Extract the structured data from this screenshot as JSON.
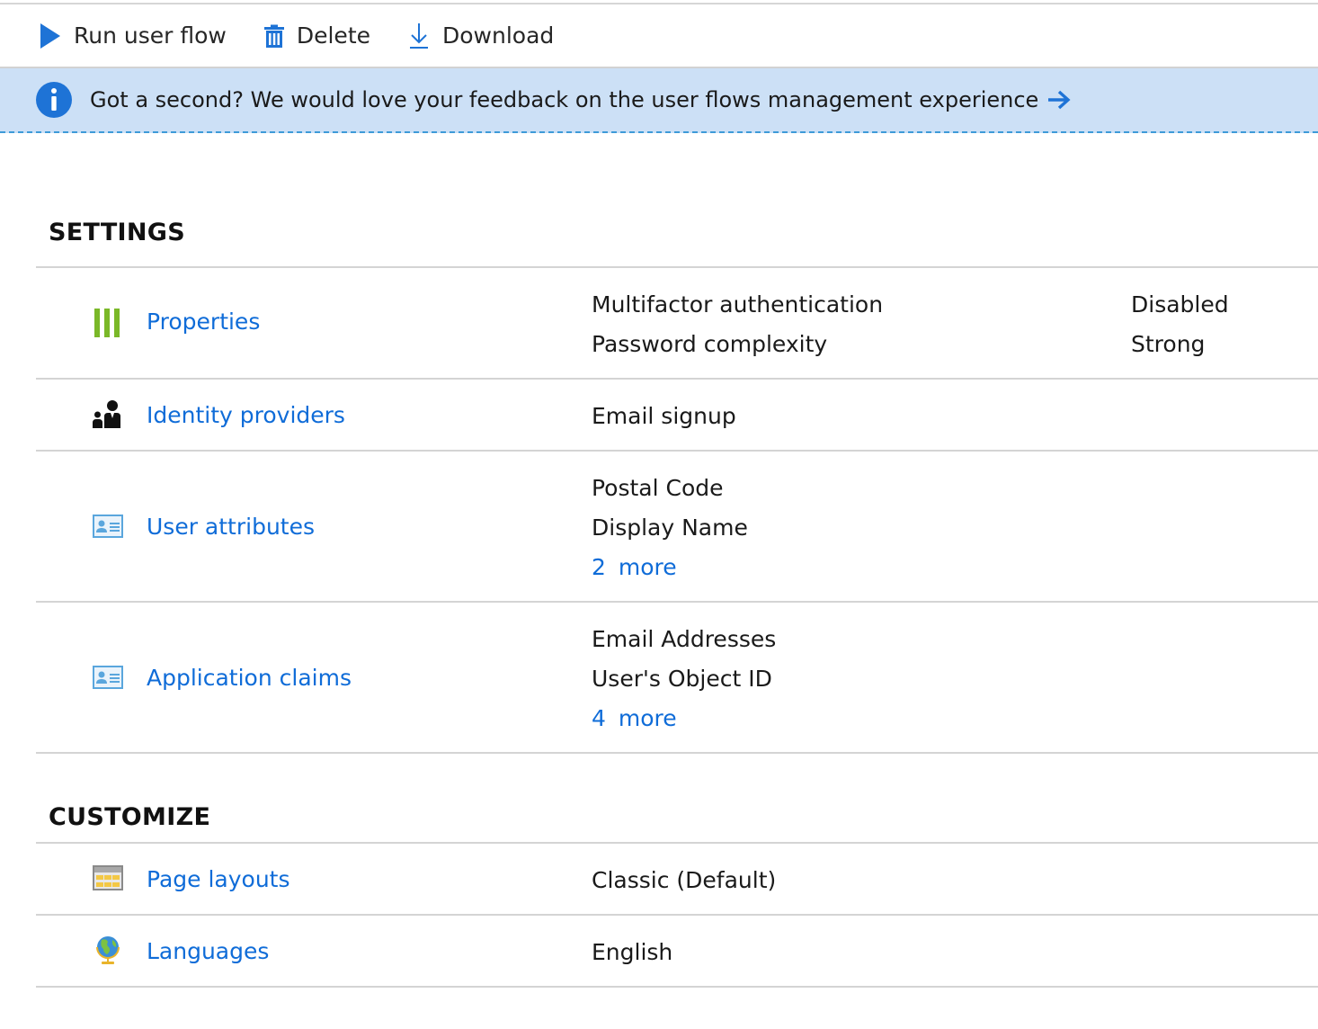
{
  "toolbar": {
    "run_label": "Run user flow",
    "delete_label": "Delete",
    "download_label": "Download"
  },
  "banner": {
    "message": "Got a second? We would love your feedback on the user flows management experience"
  },
  "settings": {
    "title": "SETTINGS",
    "properties": {
      "label": "Properties",
      "items": [
        {
          "name": "Multifactor authentication",
          "value": "Disabled"
        },
        {
          "name": "Password complexity",
          "value": "Strong"
        }
      ]
    },
    "identity_providers": {
      "label": "Identity providers",
      "values": [
        "Email signup"
      ]
    },
    "user_attributes": {
      "label": "User attributes",
      "values": [
        "Postal Code",
        "Display Name"
      ],
      "more": "2  more"
    },
    "application_claims": {
      "label": "Application claims",
      "values": [
        "Email Addresses",
        "User's Object ID"
      ],
      "more": "4  more"
    }
  },
  "customize": {
    "title": "CUSTOMIZE",
    "page_layouts": {
      "label": "Page layouts",
      "value": "Classic (Default)"
    },
    "languages": {
      "label": "Languages",
      "value": "English"
    }
  },
  "icons": {
    "run": "play-icon",
    "delete": "trash-icon",
    "download": "download-icon",
    "info": "info-icon",
    "feedback_arrow": "arrow-right-icon",
    "properties": "properties-bars-icon",
    "identity_providers": "people-icon",
    "user_attributes": "id-card-icon",
    "application_claims": "id-card-icon",
    "page_layouts": "table-layout-icon",
    "languages": "globe-icon"
  },
  "colors": {
    "link": "#0f6cd8",
    "banner_bg": "#cce0f6",
    "accent": "#1e73d6",
    "properties_icon": "#7ab828"
  }
}
